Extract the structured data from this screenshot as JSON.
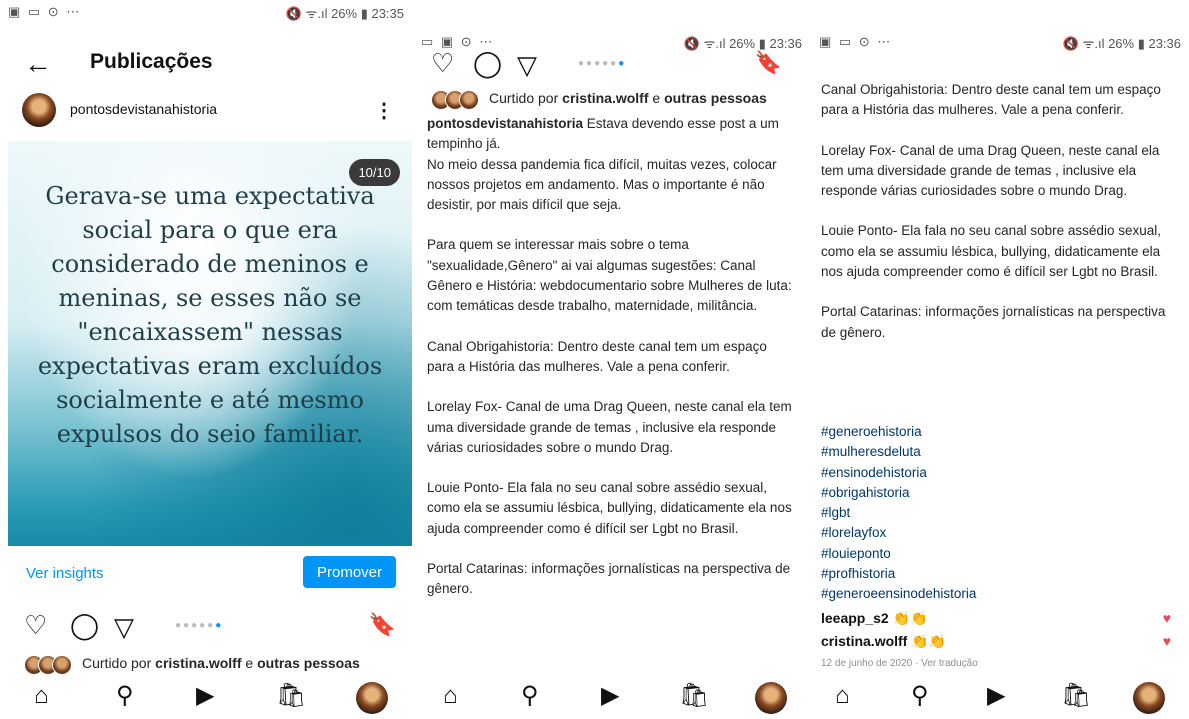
{
  "panels": {
    "p1": {
      "status": {
        "left": "▣ ▭ ⊙ ⋯",
        "right": "🔇 ᯤ.ıl 26% ▮ 23:35"
      },
      "title": "Publicações",
      "username": "pontosdevistanahistoria",
      "post": {
        "counter": "10/10",
        "quote": "Gerava-se uma expectativa social  para o que era considerado de meninos e meninas, se esses não se \"encaixassem\" nessas expectativas  eram excluídos socialmente e até  mesmo expulsos do seio familiar."
      },
      "insights_label": "Ver insights",
      "promote_label": "Promover",
      "likes": {
        "prefix": "Curtido por ",
        "user": "cristina.wolff",
        "middle": " e ",
        "others": "outras pessoas"
      }
    },
    "p2": {
      "status": {
        "left": "▭ ▣ ⊙ ⋯",
        "right": "🔇 ᯤ.ıl 26% ▮ 23:36"
      },
      "likes": {
        "prefix": "Curtido por ",
        "user": "cristina.wolff",
        "middle": " e ",
        "others": "outras pessoas"
      },
      "caption": {
        "author": "pontosdevistanahistoria",
        "p1": " Estava devendo esse post a um tempinho já.",
        "p1b": "No meio dessa pandemia fica difícil, muitas vezes, colocar nossos projetos em andamento. Mas o importante é  não desistir, por mais difícil que seja.",
        "p2": "Para quem se interessar mais sobre o tema \"sexualidade,Gênero\" ai vai algumas sugestões: Canal Gênero e História: webdocumentario sobre Mulheres de luta: com temáticas desde trabalho, maternidade, militância.",
        "p3": "Canal Obrigahistoria: Dentro deste canal tem um espaço para a História das mulheres. Vale a pena conferir.",
        "p4": "Lorelay Fox- Canal de uma Drag Queen, neste canal ela tem uma diversidade grande de temas , inclusive ela responde várias curiosidades sobre o mundo Drag.",
        "p5": "Louie Ponto- Ela fala no seu canal sobre assédio sexual, como ela se assumiu lésbica, bullying, didaticamente ela nos ajuda compreender como é difícil ser Lgbt no Brasil.",
        "p6": "Portal Catarinas: informações jornalísticas na perspectiva de gênero."
      }
    },
    "p3": {
      "status": {
        "left": "▣ ▭ ⊙ ⋯",
        "right": "🔇 ᯤ.ıl 26% ▮ 23:36"
      },
      "caption": {
        "p3": "Canal Obrigahistoria: Dentro deste canal tem um espaço para a História das mulheres. Vale a pena conferir.",
        "p4": "Lorelay Fox- Canal de uma Drag Queen, neste canal ela tem uma diversidade grande de temas , inclusive ela responde várias curiosidades sobre o mundo Drag.",
        "p5": "Louie Ponto- Ela fala no seu canal sobre assédio sexual, como ela se assumiu lésbica, bullying, didaticamente ela nos ajuda compreender como é difícil ser Lgbt no Brasil.",
        "p6": "Portal Catarinas: informações jornalísticas na perspectiva de gênero."
      },
      "hashtags": [
        "#generoehistoria",
        "#mulheresdeluta",
        "#ensinodehistoria",
        "#obrigahistoria",
        "#lgbt",
        "#lorelayfox",
        "#louieponto",
        "#profhistoria",
        "#generoeensinodehistoria"
      ],
      "comments": [
        {
          "user": "leeapp_s2",
          "text": "👏👏"
        },
        {
          "user": "cristina.wolff",
          "text": "👏👏"
        }
      ],
      "date_line": "12 de junho de 2020 · Ver tradução"
    }
  },
  "icons": {
    "back": "←",
    "more": "⋮",
    "heart": "♡",
    "comment": "◯",
    "share": "▽",
    "bookmark": "🔖",
    "home": "⌂",
    "search": "⚲",
    "reels": "▶",
    "shop": "🛍",
    "heart_red": "♥"
  },
  "carousel_dots": {
    "count": 6,
    "active_index": 5
  },
  "colors": {
    "accent": "#0095f6",
    "hashtag": "#00376b",
    "like_red": "#ed4956"
  }
}
